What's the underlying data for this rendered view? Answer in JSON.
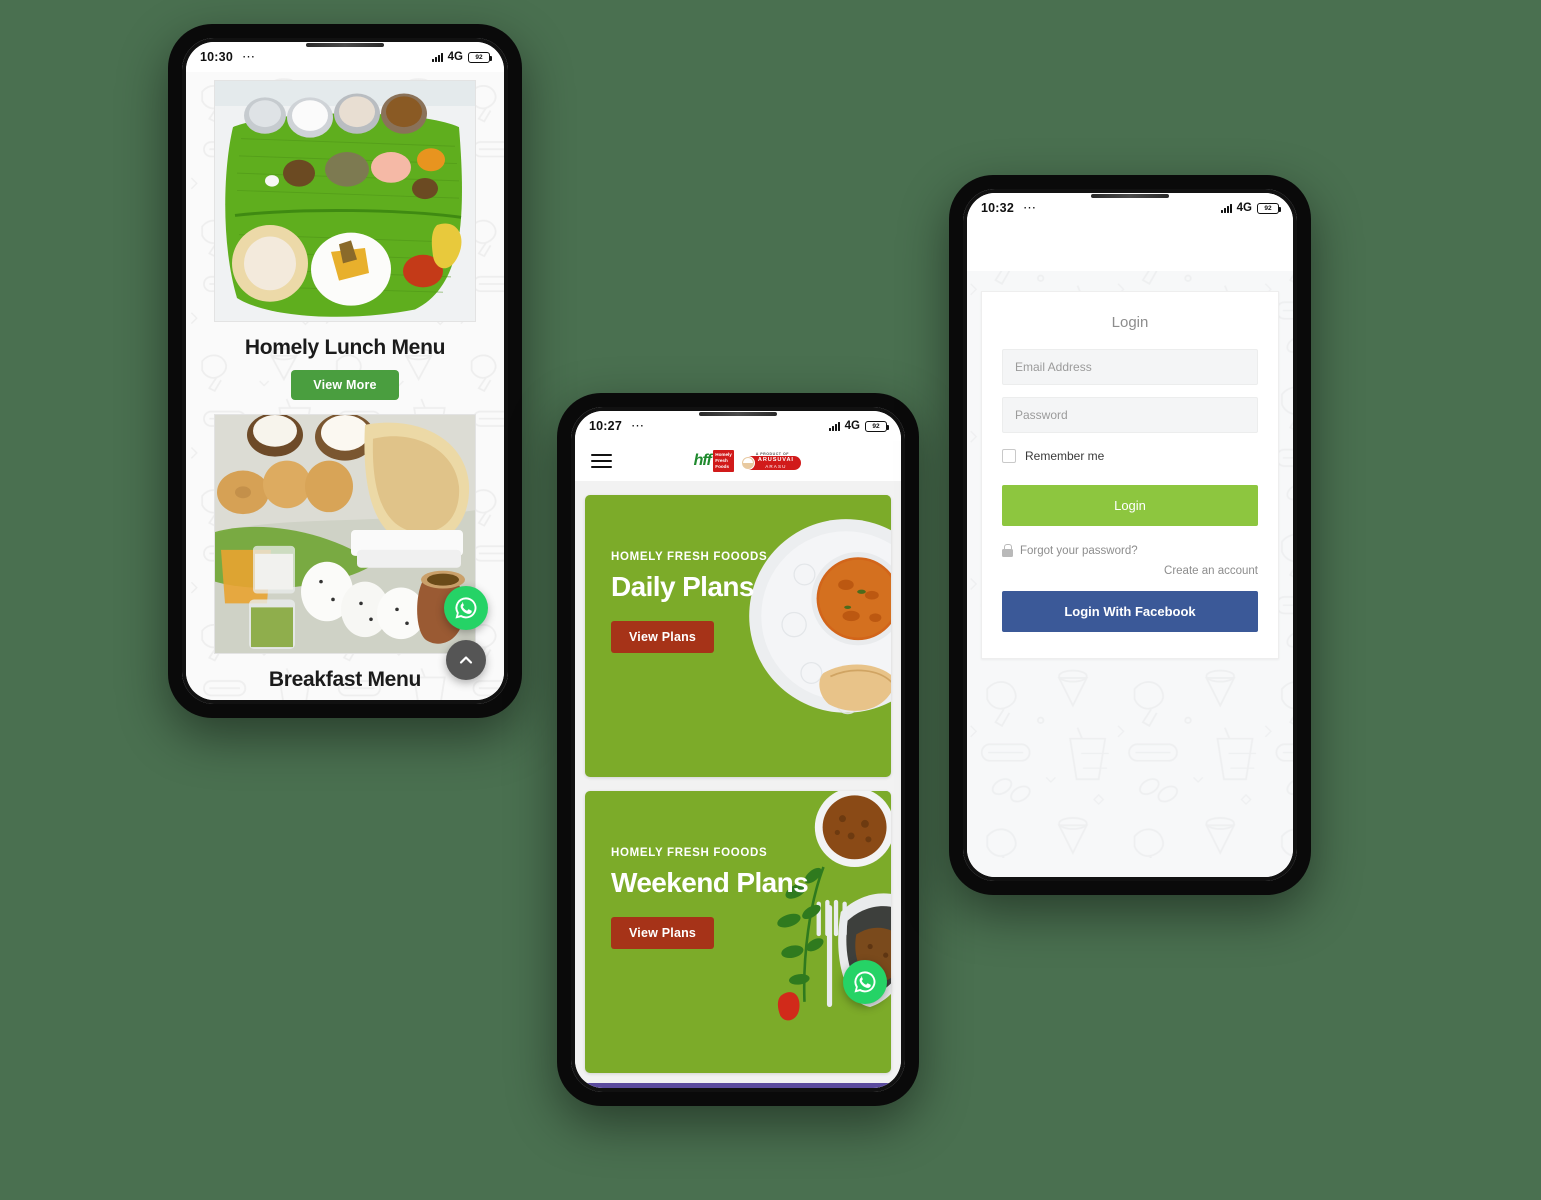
{
  "page": {
    "background_color": "#4a7050",
    "brand": "Homely Fresh Foods"
  },
  "phones": [
    {
      "id": "phone-home-menu",
      "status_bar": {
        "time": "10:30",
        "dots": "⋯",
        "network": "4G",
        "network_sub": "↓↑",
        "battery_level": "92",
        "signal_icon": "signal-bars-icon",
        "battery_icon": "battery-icon"
      },
      "sections": [
        {
          "image_alt": "South Indian banana leaf thali meal with steel cups of rasam, curd, payasam and sambar",
          "title": "Homely Lunch Menu",
          "button_label": "View More"
        },
        {
          "image_alt": "South Indian breakfast spread with vada, dosa, idli, coconut and chutneys",
          "title": "Breakfast Menu"
        }
      ],
      "floating_buttons": [
        {
          "name": "whatsapp-button",
          "icon": "whatsapp-icon",
          "color": "#25d366"
        },
        {
          "name": "scroll-to-top-button",
          "icon": "chevron-up-icon",
          "color": "#555555"
        }
      ]
    },
    {
      "id": "phone-plans",
      "status_bar": {
        "time": "10:27",
        "dots": "⋯",
        "network": "4G",
        "network_sub": "↓↑",
        "battery_level": "92",
        "signal_icon": "signal-bars-icon",
        "battery_icon": "battery-icon"
      },
      "header": {
        "menu_icon": "hamburger-menu-icon",
        "logo_primary": {
          "mark": "hff",
          "line1": "Homely",
          "line2": "Fresh",
          "line3": "Foods"
        },
        "logo_secondary": {
          "prefix": "A PRODUCT OF",
          "name": "ARUSUVAI",
          "name2": "ARASU"
        }
      },
      "cards": [
        {
          "kicker": "HOMELY FRESH FOOODS",
          "title": "Daily Plans",
          "button_label": "View Plans",
          "image_alt": "Bowl of sambar on a white plate with dosa",
          "bg_color": "#7cab29",
          "button_color": "#a63318"
        },
        {
          "kicker": "HOMELY FRESH FOOODS",
          "title": "Weekend Plans",
          "button_label": "View Plans",
          "image_alt": "Bowl of spice powder with curry leaves, fork and grilled fish",
          "bg_color": "#7cab29",
          "button_color": "#a63318"
        }
      ],
      "floating_buttons": [
        {
          "name": "whatsapp-button",
          "icon": "whatsapp-icon",
          "color": "#25d366"
        }
      ]
    },
    {
      "id": "phone-login",
      "status_bar": {
        "time": "10:32",
        "dots": "⋯",
        "network": "4G",
        "network_sub": "↓↑",
        "battery_level": "92",
        "signal_icon": "signal-bars-icon",
        "battery_icon": "battery-icon"
      },
      "login": {
        "heading": "Login",
        "email_placeholder": "Email Address",
        "email_value": "",
        "password_placeholder": "Password",
        "password_value": "",
        "remember_label": "Remember me",
        "remember_checked": false,
        "submit_label": "Login",
        "submit_color": "#8dc63f",
        "forgot_label": "Forgot your password?",
        "forgot_icon": "lock-icon",
        "create_account_label": "Create an account",
        "facebook_label": "Login With Facebook",
        "facebook_color": "#3b5998"
      }
    }
  ]
}
